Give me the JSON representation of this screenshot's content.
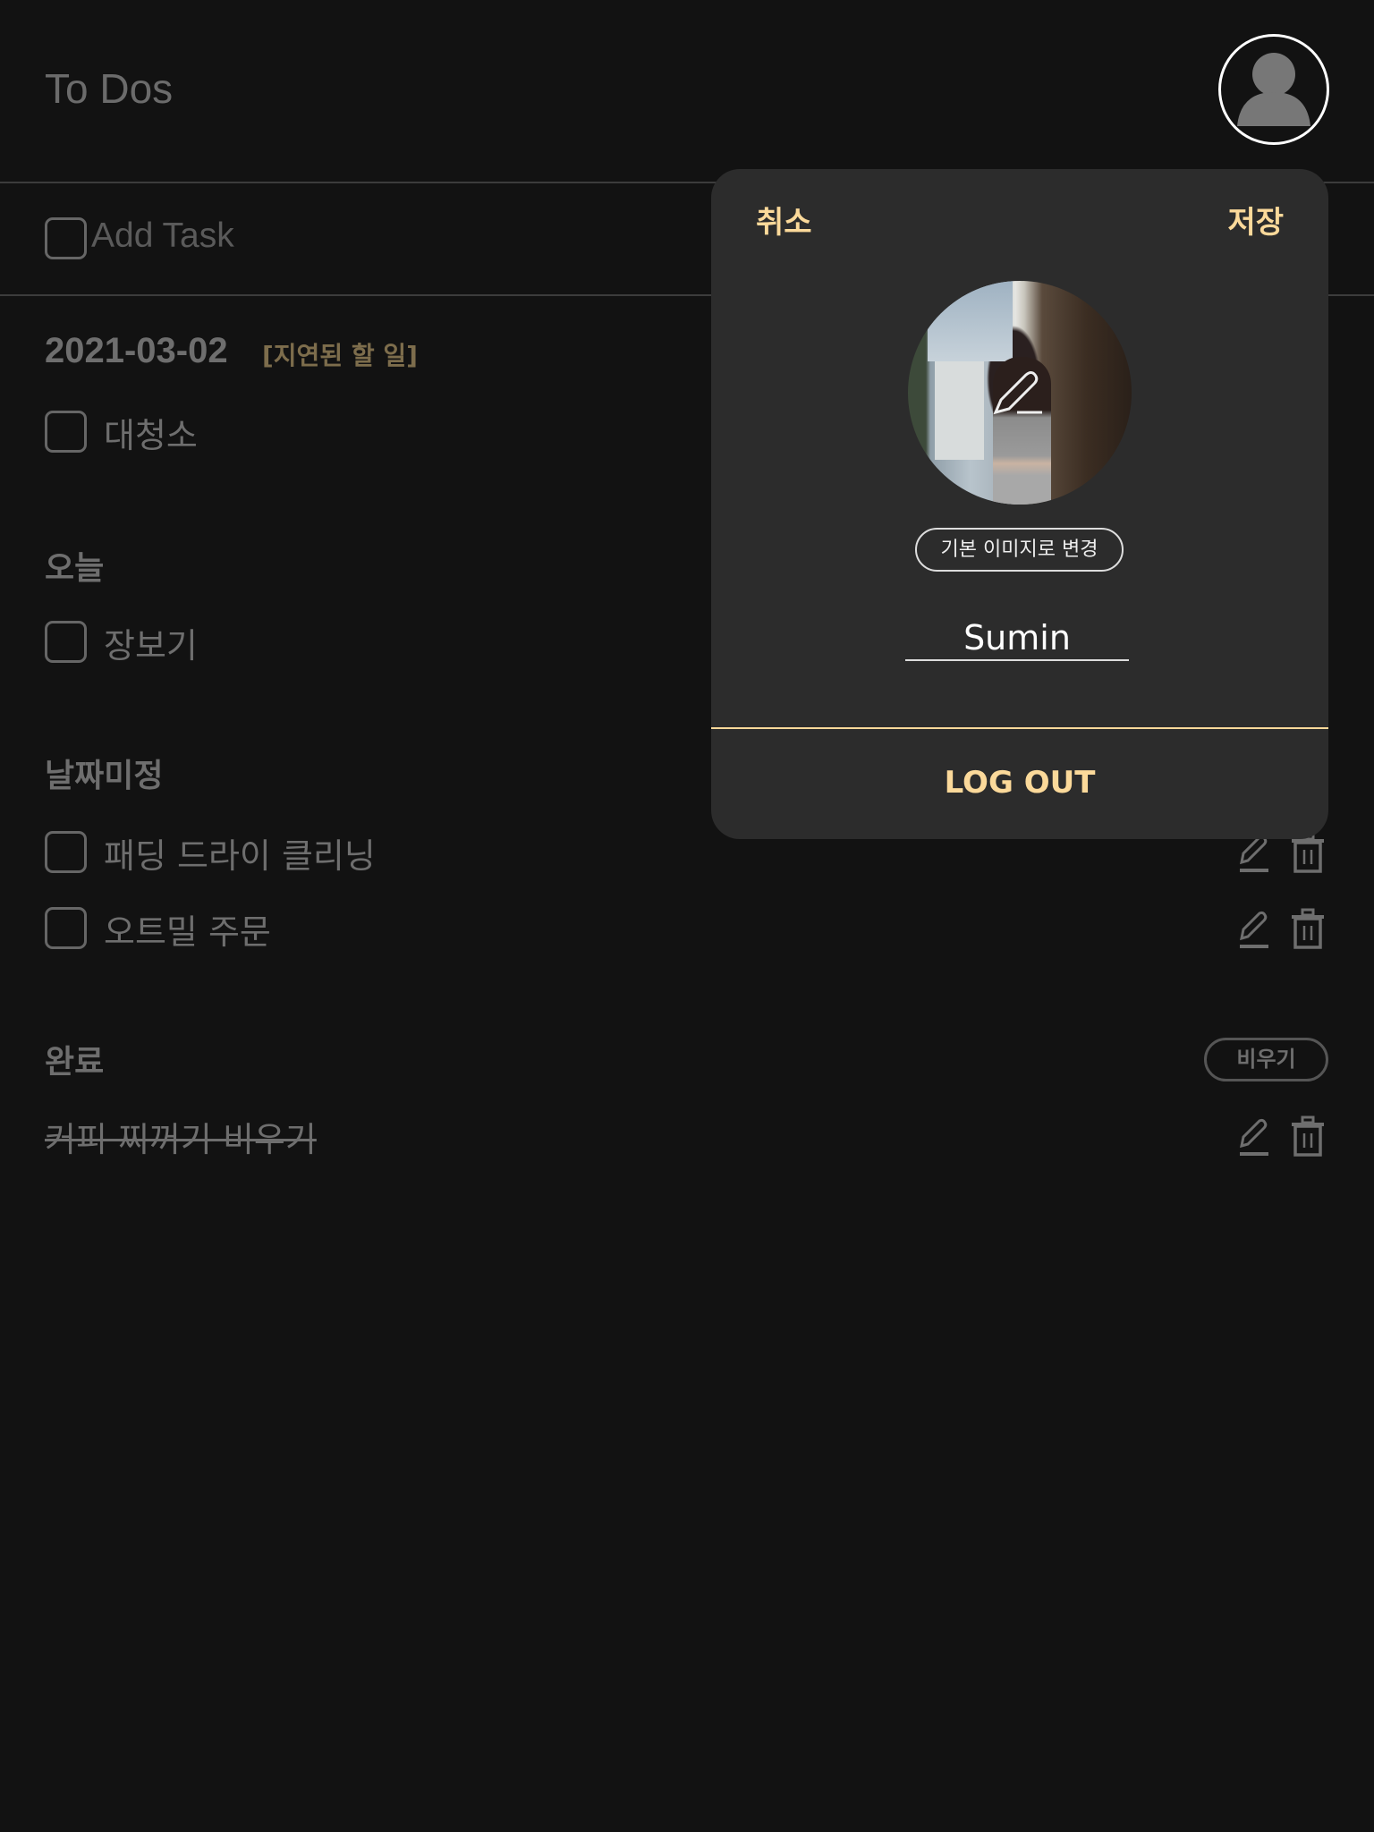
{
  "header": {
    "title": "To Dos",
    "avatar_icon": "user-icon"
  },
  "add_task": {
    "placeholder": "Add Task"
  },
  "sections": {
    "overdue": {
      "date": "2021-03-02",
      "label": "[지연된 할 일]",
      "items": [
        "대청소"
      ]
    },
    "today": {
      "title": "오늘",
      "items": [
        "장보기"
      ]
    },
    "undated": {
      "title": "날짜미정",
      "items": [
        "패딩 드라이 클리닝",
        "오트밀 주문"
      ]
    },
    "done": {
      "title": "완료",
      "clear_label": "비우기",
      "items": [
        "커피 찌꺼기 비우기"
      ]
    }
  },
  "profile_popup": {
    "cancel_label": "취소",
    "save_label": "저장",
    "reset_image_label": "기본 이미지로 변경",
    "name_value": "Sumin",
    "logout_label": "LOG OUT"
  },
  "colors": {
    "background": "#121212",
    "popup": "#2c2c2c",
    "accent": "#fbd99a",
    "overdue_label": "#7d6d4c"
  }
}
